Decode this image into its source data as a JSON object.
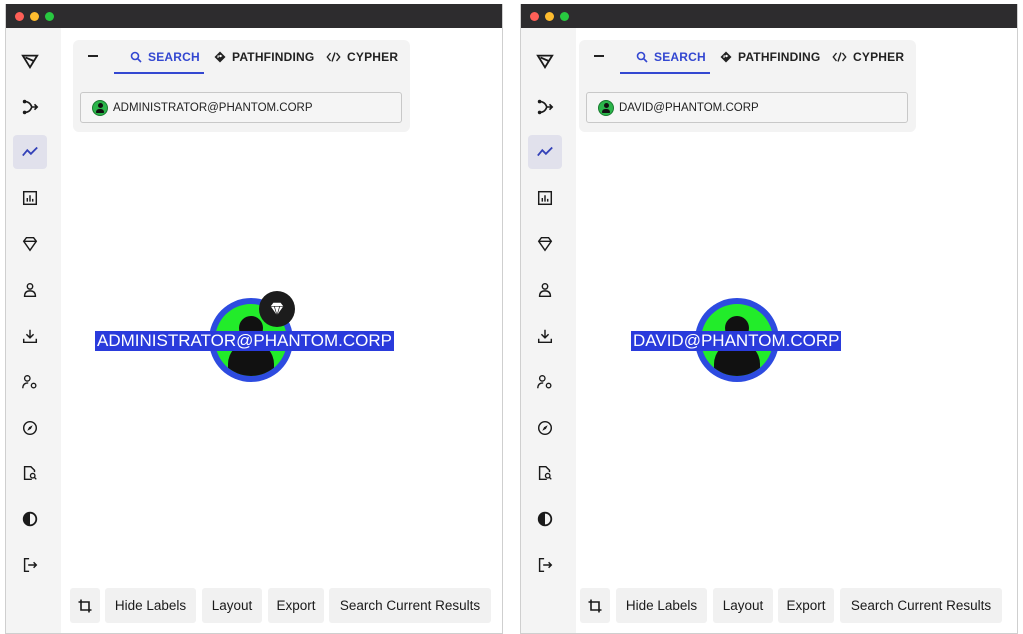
{
  "colors": {
    "accent": "#3347d1",
    "node_fill": "#22ec2a",
    "node_ring": "#2d4be0",
    "label_bg": "#2a3bdc"
  },
  "sidebar_icons": [
    "logo-icon",
    "branch-arrow-icon",
    "trend-chart-icon",
    "bar-chart-icon",
    "diamond-icon",
    "user-icon",
    "download-icon",
    "user-gear-icon",
    "compass-icon",
    "file-search-icon",
    "contrast-icon",
    "logout-icon"
  ],
  "active_sidebar_icon": "trend-chart-icon",
  "windows": [
    {
      "tabs": {
        "search": "SEARCH",
        "pathfinding": "PATHFINDING",
        "cypher": "CYPHER"
      },
      "search_node": "ADMINISTRATOR@PHANTOM.CORP",
      "graph_node": {
        "label": "ADMINISTRATOR@PHANTOM.CORP",
        "badge": "diamond-icon"
      },
      "toolbar": {
        "hide_labels": "Hide Labels",
        "layout": "Layout",
        "export": "Export",
        "search_current": "Search Current Results"
      }
    },
    {
      "tabs": {
        "search": "SEARCH",
        "pathfinding": "PATHFINDING",
        "cypher": "CYPHER"
      },
      "search_node": "DAVID@PHANTOM.CORP",
      "graph_node": {
        "label": "DAVID@PHANTOM.CORP"
      },
      "toolbar": {
        "hide_labels": "Hide Labels",
        "layout": "Layout",
        "export": "Export",
        "search_current": "Search Current Results"
      }
    }
  ]
}
